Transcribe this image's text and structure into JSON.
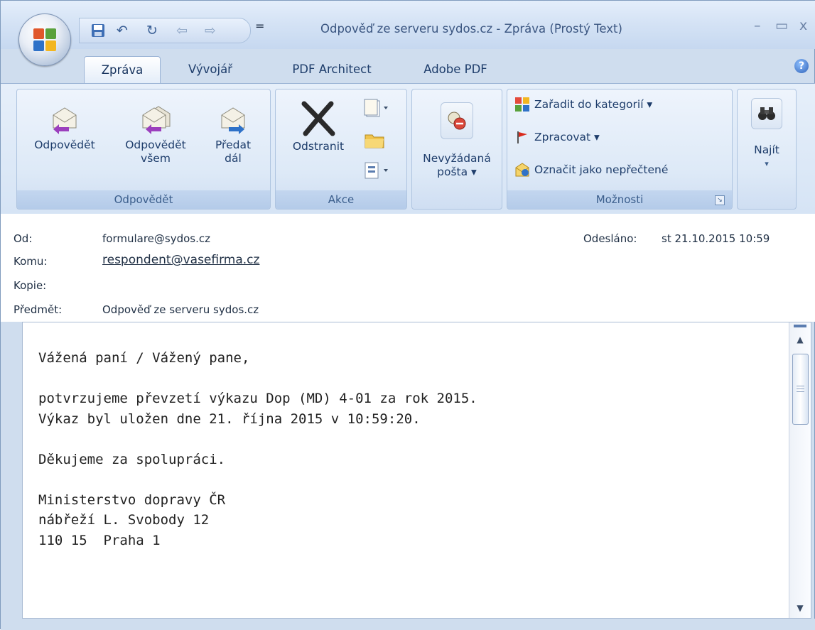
{
  "window": {
    "title": "Odpověď ze serveru sydos.cz - Zpráva (Prostý Text)",
    "controls": {
      "minimize": "–",
      "maximize": "▭",
      "close": "x"
    }
  },
  "quick_access": {
    "dropdown": "="
  },
  "tabs": [
    {
      "label": "Zpráva",
      "active": true
    },
    {
      "label": "Vývojář"
    },
    {
      "label": "PDF Architect"
    },
    {
      "label": "Adobe PDF"
    }
  ],
  "ribbon": {
    "respond": {
      "label": "Odpovědět",
      "reply": "Odpovědět",
      "reply_all_1": "Odpovědět",
      "reply_all_2": "všem",
      "forward_1": "Předat",
      "forward_2": "dál"
    },
    "actions": {
      "label": "Akce",
      "delete": "Odstranit"
    },
    "junk": {
      "line1": "Nevyžádaná",
      "line2": "pošta ▾"
    },
    "options": {
      "label": "Možnosti",
      "categorize": "Zařadit do kategorií ▾",
      "follow_up": "Zpracovat ▾",
      "mark_unread": "Označit jako nepřečtené"
    },
    "find": {
      "label": "Najít",
      "arrow": "▾"
    }
  },
  "header": {
    "from_label": "Od:",
    "from_value": "formulare@sydos.cz",
    "sent_label": "Odesláno:",
    "sent_value": "st 21.10.2015 10:59",
    "to_label": "Komu:",
    "to_value": "respondent@vasefirma.cz",
    "cc_label": "Kopie:",
    "subject_label": "Předmět:",
    "subject_value": "Odpověď ze serveru sydos.cz"
  },
  "body": {
    "text": "Vážená paní / Vážený pane,\n\npotvrzujeme převzetí výkazu Dop (MD) 4-01 za rok 2015.\nVýkaz byl uložen dne 21. října 2015 v 10:59:20.\n\nDěkujeme za spolupráci.\n\nMinisterstvo dopravy ČR\nnábřeží L. Svobody 12\n110 15  Praha 1"
  },
  "colors": {
    "ribbon_bg": "#d6e4f5",
    "accent": "#1e3d6b",
    "group_label_bg": "#b4cbe9"
  }
}
